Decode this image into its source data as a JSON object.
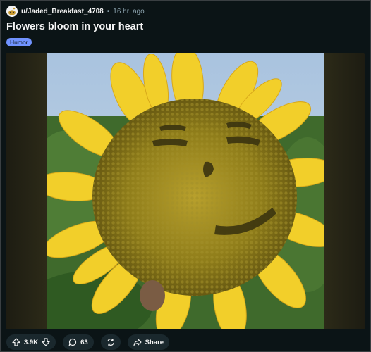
{
  "post": {
    "username": "u/Jaded_Breakfast_4708",
    "separator": "•",
    "time": "16 hr. ago",
    "title": "Flowers bloom in your heart",
    "flair": "Humor"
  },
  "actions": {
    "votes": "3.9K",
    "comments": "63",
    "share_label": "Share"
  },
  "colors": {
    "background": "#0b1416",
    "flair": "#7193ff",
    "pill": "#1a282d",
    "meta": "#8ba2ad"
  },
  "icons": [
    "snoo-avatar-icon",
    "upvote-icon",
    "downvote-icon",
    "comment-icon",
    "crosspost-icon",
    "share-icon"
  ]
}
